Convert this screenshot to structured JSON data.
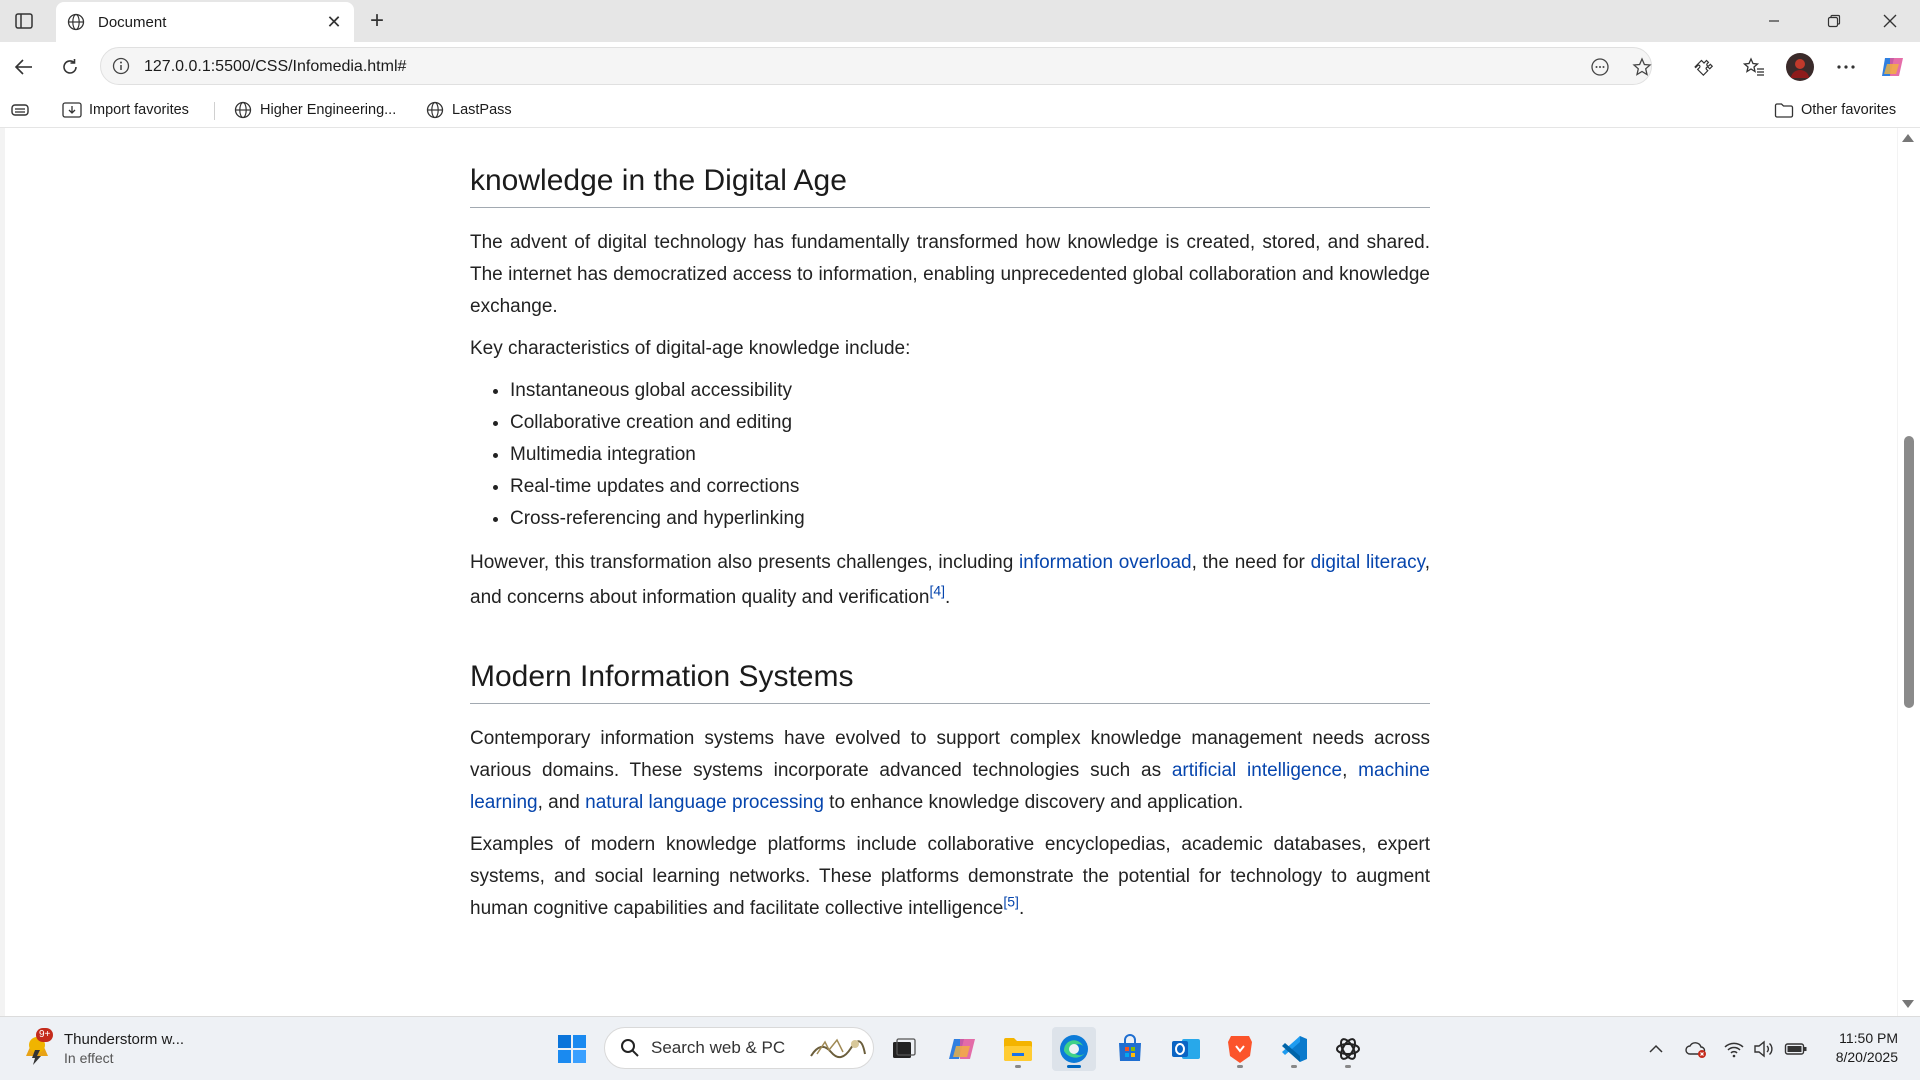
{
  "browser": {
    "tab": {
      "title": "Document",
      "close_glyph": "✕"
    },
    "new_tab_glyph": "+",
    "address": {
      "url": "127.0.0.1:5500/CSS/Infomedia.html#"
    },
    "favorites": [
      {
        "label": "Import favorites",
        "icon": "import-favorites-icon"
      },
      {
        "label": "Higher Engineering...",
        "icon": "globe-icon"
      },
      {
        "label": "LastPass",
        "icon": "globe-icon"
      }
    ],
    "other_favorites": "Other favorites"
  },
  "article": {
    "section1": {
      "heading": "knowledge in the Digital Age",
      "para1": "The advent of digital technology has fundamentally transformed how knowledge is created, stored, and shared. The internet has democratized access to information, enabling unprecedented global collaboration and knowledge exchange.",
      "list_intro": "Key characteristics of digital-age knowledge include:",
      "list": [
        "Instantaneous global accessibility",
        "Collaborative creation and editing",
        "Multimedia integration",
        "Real-time updates and corrections",
        "Cross-referencing and hyperlinking"
      ],
      "para3": {
        "t1": "However, this transformation also presents challenges, including ",
        "link1": "information overload",
        "t2": ", the need for ",
        "link2": "digital literacy",
        "t3": ", and concerns about information quality and verification",
        "ref": "[4]",
        "t4": "."
      }
    },
    "section2": {
      "heading": "Modern Information Systems",
      "para1": {
        "t1": "Contemporary information systems have evolved to support complex knowledge management needs across various domains. These systems incorporate advanced technologies such as ",
        "link1": "artificial intelligence",
        "t2": ", ",
        "link2": "machine learning",
        "t3": ", and ",
        "link3": "natural language processing",
        "t4": " to enhance knowledge discovery and application."
      },
      "para2": {
        "t1": "Examples of modern knowledge platforms include collaborative encyclopedias, academic databases, expert systems, and social learning networks. These platforms demonstrate the potential for technology to augment human cognitive capabilities and facilitate collective intelligence",
        "ref": "[5]",
        "t2": "."
      }
    }
  },
  "taskbar": {
    "weather": {
      "title": "Thunderstorm w...",
      "subtitle": "In effect",
      "badge": "9+"
    },
    "search_placeholder": "Search web & PC",
    "clock": {
      "time": "11:50 PM",
      "date": "8/20/2025"
    }
  },
  "colors": {
    "link": "#0645ad",
    "accent": "#0067c0",
    "badge": "#c42b1c"
  }
}
